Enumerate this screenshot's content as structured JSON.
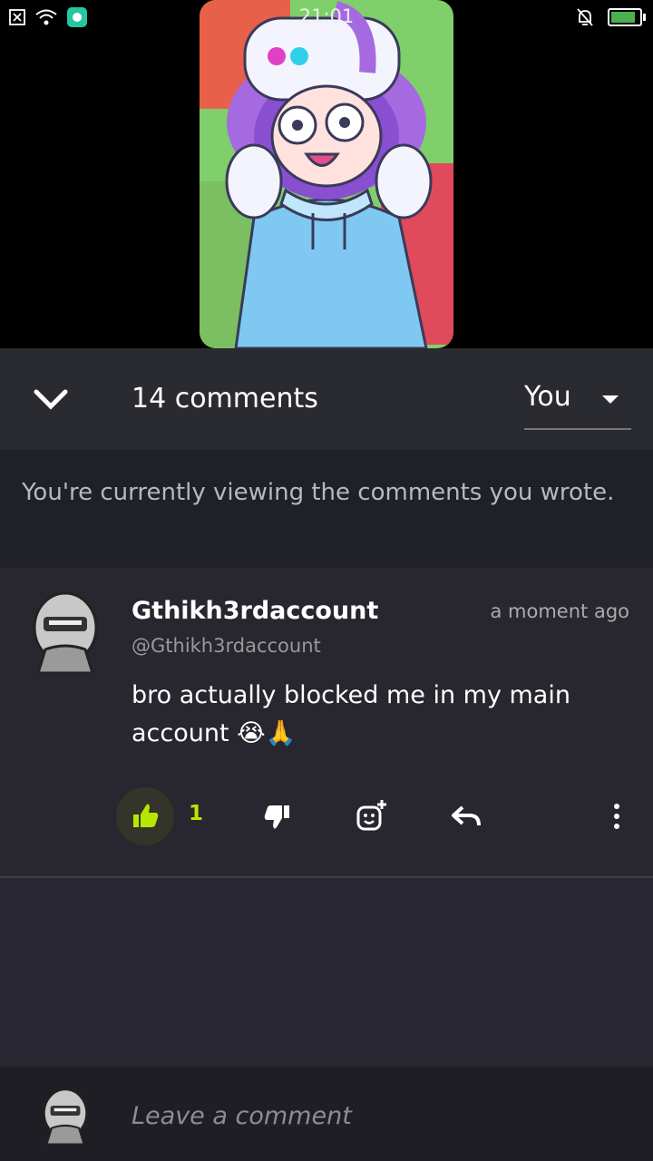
{
  "status_bar": {
    "time": "21:01"
  },
  "comments_panel": {
    "count_label": "14 comments",
    "filter_selected": "You",
    "notice": "You're currently viewing the comments you wrote."
  },
  "comment": {
    "author": "Gthikh3rdaccount",
    "handle": "@Gthikh3rdaccount",
    "time": "a moment ago",
    "text": "bro actually blocked me in my main account 😭🙏",
    "likes": "1"
  },
  "compose": {
    "placeholder": "Leave a comment"
  },
  "colors": {
    "accent": "#b8e600",
    "panel": "#272631",
    "header": "#2a2a31",
    "notice_bg": "#202028"
  }
}
